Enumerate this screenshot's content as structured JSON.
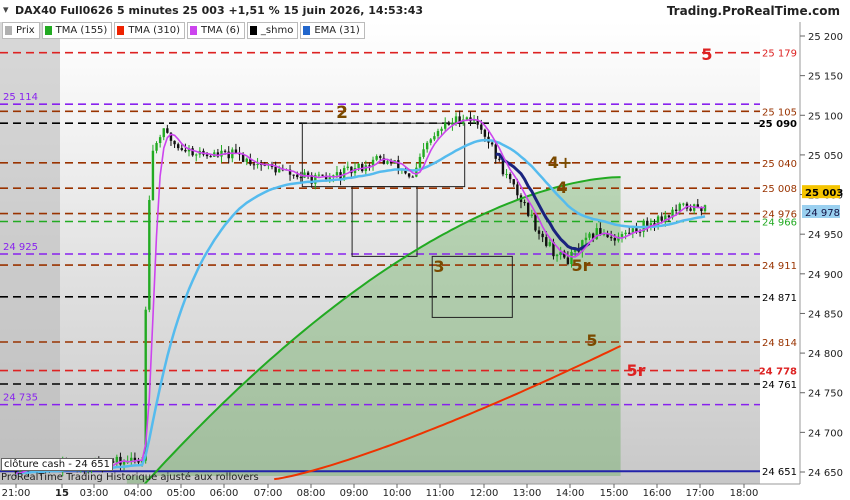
{
  "header": {
    "title": "DAX40 Full0626 5 minutes 25 003 +1,51 % 15 juin 2026, 14:53:43",
    "brand": "Trading.ProRealTime.com"
  },
  "legend": [
    {
      "label": "Prix",
      "color": "#b0b0b0"
    },
    {
      "label": "TMA (155)",
      "color": "#22aa22"
    },
    {
      "label": "TMA (310)",
      "color": "#ee2200"
    },
    {
      "label": "TMA (6)",
      "color": "#cc44ee"
    },
    {
      "label": "_shmo",
      "color": "#000000"
    },
    {
      "label": "EMA (31)",
      "color": "#2266cc"
    }
  ],
  "footer": {
    "close_label": "clôture cash - 24 651",
    "copyright": "ProRealTime Trading  Historique ajusté aux rollovers"
  },
  "chart_data": {
    "type": "line",
    "y_axis_ticks": [
      24650,
      24700,
      24750,
      24800,
      24850,
      24900,
      24950,
      25000,
      25050,
      25100,
      25150,
      25200
    ],
    "y_tick_labels": [
      "24 650",
      "24 700",
      "24 750",
      "24 800",
      "24 850",
      "24 900",
      "24 950",
      "25 000",
      "25 050",
      "25 100",
      "25 150",
      "25 200"
    ],
    "ylim": [
      24640,
      25215
    ],
    "x_tick_labels": [
      "21:00",
      "15",
      "03:00",
      "04:00",
      "05:00",
      "06:00",
      "07:00",
      "08:00",
      "09:00",
      "10:00",
      "11:00",
      "12:00",
      "13:00",
      "14:00",
      "15:00",
      "16:00",
      "17:00",
      "18:00"
    ],
    "price_labels": [
      {
        "text": "25 179",
        "value": 25179,
        "color": "#dd2222"
      },
      {
        "text": "25 105",
        "value": 25105,
        "color": "#993300"
      },
      {
        "text": "25 090",
        "value": 25090,
        "color": "#000000"
      },
      {
        "text": "25 040",
        "value": 25040,
        "color": "#993300"
      },
      {
        "text": "25 008",
        "value": 25008,
        "color": "#993300"
      },
      {
        "text": "24 976",
        "value": 24976,
        "color": "#993300"
      },
      {
        "text": "24 966",
        "value": 24966,
        "color": "#22aa22"
      },
      {
        "text": "24 911",
        "value": 24911,
        "color": "#993300"
      },
      {
        "text": "24 871",
        "value": 24871,
        "color": "#000000"
      },
      {
        "text": "24 814",
        "value": 24814,
        "color": "#993300"
      },
      {
        "text": "24 778",
        "value": 24778,
        "color": "#dd2222"
      },
      {
        "text": "24 761",
        "value": 24761,
        "color": "#000000"
      },
      {
        "text": "24 651",
        "value": 24651,
        "color": "#000000"
      }
    ],
    "current_price": {
      "text": "25 003",
      "value": 25003
    },
    "ema_value": {
      "text": "24 978",
      "value": 24978
    },
    "left_labels": [
      {
        "text": "25 114",
        "value": 25114
      },
      {
        "text": "24 925",
        "value": 24925
      },
      {
        "text": "24 735",
        "value": 24735
      }
    ],
    "zone_labels": [
      {
        "text": "5",
        "color": "#dd2222"
      },
      {
        "text": "2",
        "color": "#7a4a00"
      },
      {
        "text": "4+",
        "color": "#7a4a00"
      },
      {
        "text": "4",
        "color": "#7a4a00"
      },
      {
        "text": "3",
        "color": "#7a4a00"
      },
      {
        "text": "5r",
        "color": "#7a4a00"
      },
      {
        "text": "5",
        "color": "#7a4a00"
      },
      {
        "text": "5r",
        "color": "#dd2222"
      }
    ],
    "hlines": [
      {
        "value": 25179,
        "color": "#dd2222",
        "dash": true
      },
      {
        "value": 25114,
        "color": "#8822ee",
        "dash": true
      },
      {
        "value": 25105,
        "color": "#993300",
        "dash": true
      },
      {
        "value": 25090,
        "color": "#000000",
        "dash": true
      },
      {
        "value": 25040,
        "color": "#993300",
        "dash": true
      },
      {
        "value": 25008,
        "color": "#993300",
        "dash": true
      },
      {
        "value": 24976,
        "color": "#993300",
        "dash": true
      },
      {
        "value": 24966,
        "color": "#22aa22",
        "dash": true
      },
      {
        "value": 24925,
        "color": "#8822ee",
        "dash": true
      },
      {
        "value": 24911,
        "color": "#993300",
        "dash": true
      },
      {
        "value": 24871,
        "color": "#000000",
        "dash": true
      },
      {
        "value": 24814,
        "color": "#993300",
        "dash": true
      },
      {
        "value": 24778,
        "color": "#dd2222",
        "dash": true
      },
      {
        "value": 24761,
        "color": "#000000",
        "dash": true
      },
      {
        "value": 24735,
        "color": "#8822ee",
        "dash": true
      },
      {
        "value": 24651,
        "color": "#2222aa",
        "dash": false
      }
    ]
  }
}
